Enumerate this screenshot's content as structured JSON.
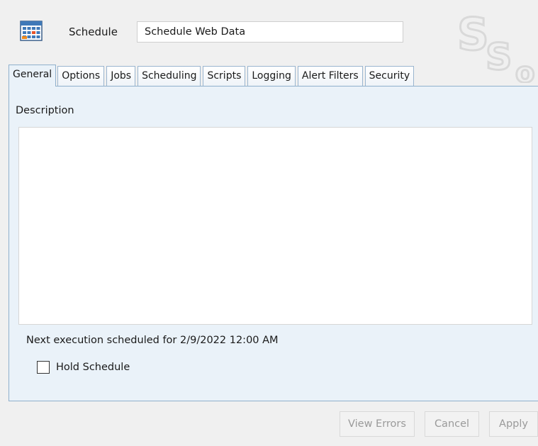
{
  "header": {
    "icon": "calendar-grid-icon",
    "schedule_label": "Schedule",
    "schedule_name": "Schedule Web Data",
    "watermark_text": "SSo"
  },
  "tabs": [
    {
      "label": "General",
      "active": true
    },
    {
      "label": "Options",
      "active": false
    },
    {
      "label": "Jobs",
      "active": false
    },
    {
      "label": "Scheduling",
      "active": false
    },
    {
      "label": "Scripts",
      "active": false
    },
    {
      "label": "Logging",
      "active": false
    },
    {
      "label": "Alert Filters",
      "active": false
    },
    {
      "label": "Security",
      "active": false
    }
  ],
  "general": {
    "description_label": "Description",
    "description_value": "",
    "next_execution_text": "Next execution scheduled for 2/9/2022 12:00 AM",
    "hold_schedule_label": "Hold Schedule",
    "hold_schedule_checked": false
  },
  "footer": {
    "view_errors_label": "View Errors",
    "cancel_label": "Cancel",
    "apply_label": "Apply",
    "buttons_enabled": false
  },
  "colors": {
    "tab_border": "#90b0cc",
    "panel_background": "#eaf2f9",
    "window_background": "#f0f0f0",
    "disabled_text": "#9a9a9a"
  }
}
